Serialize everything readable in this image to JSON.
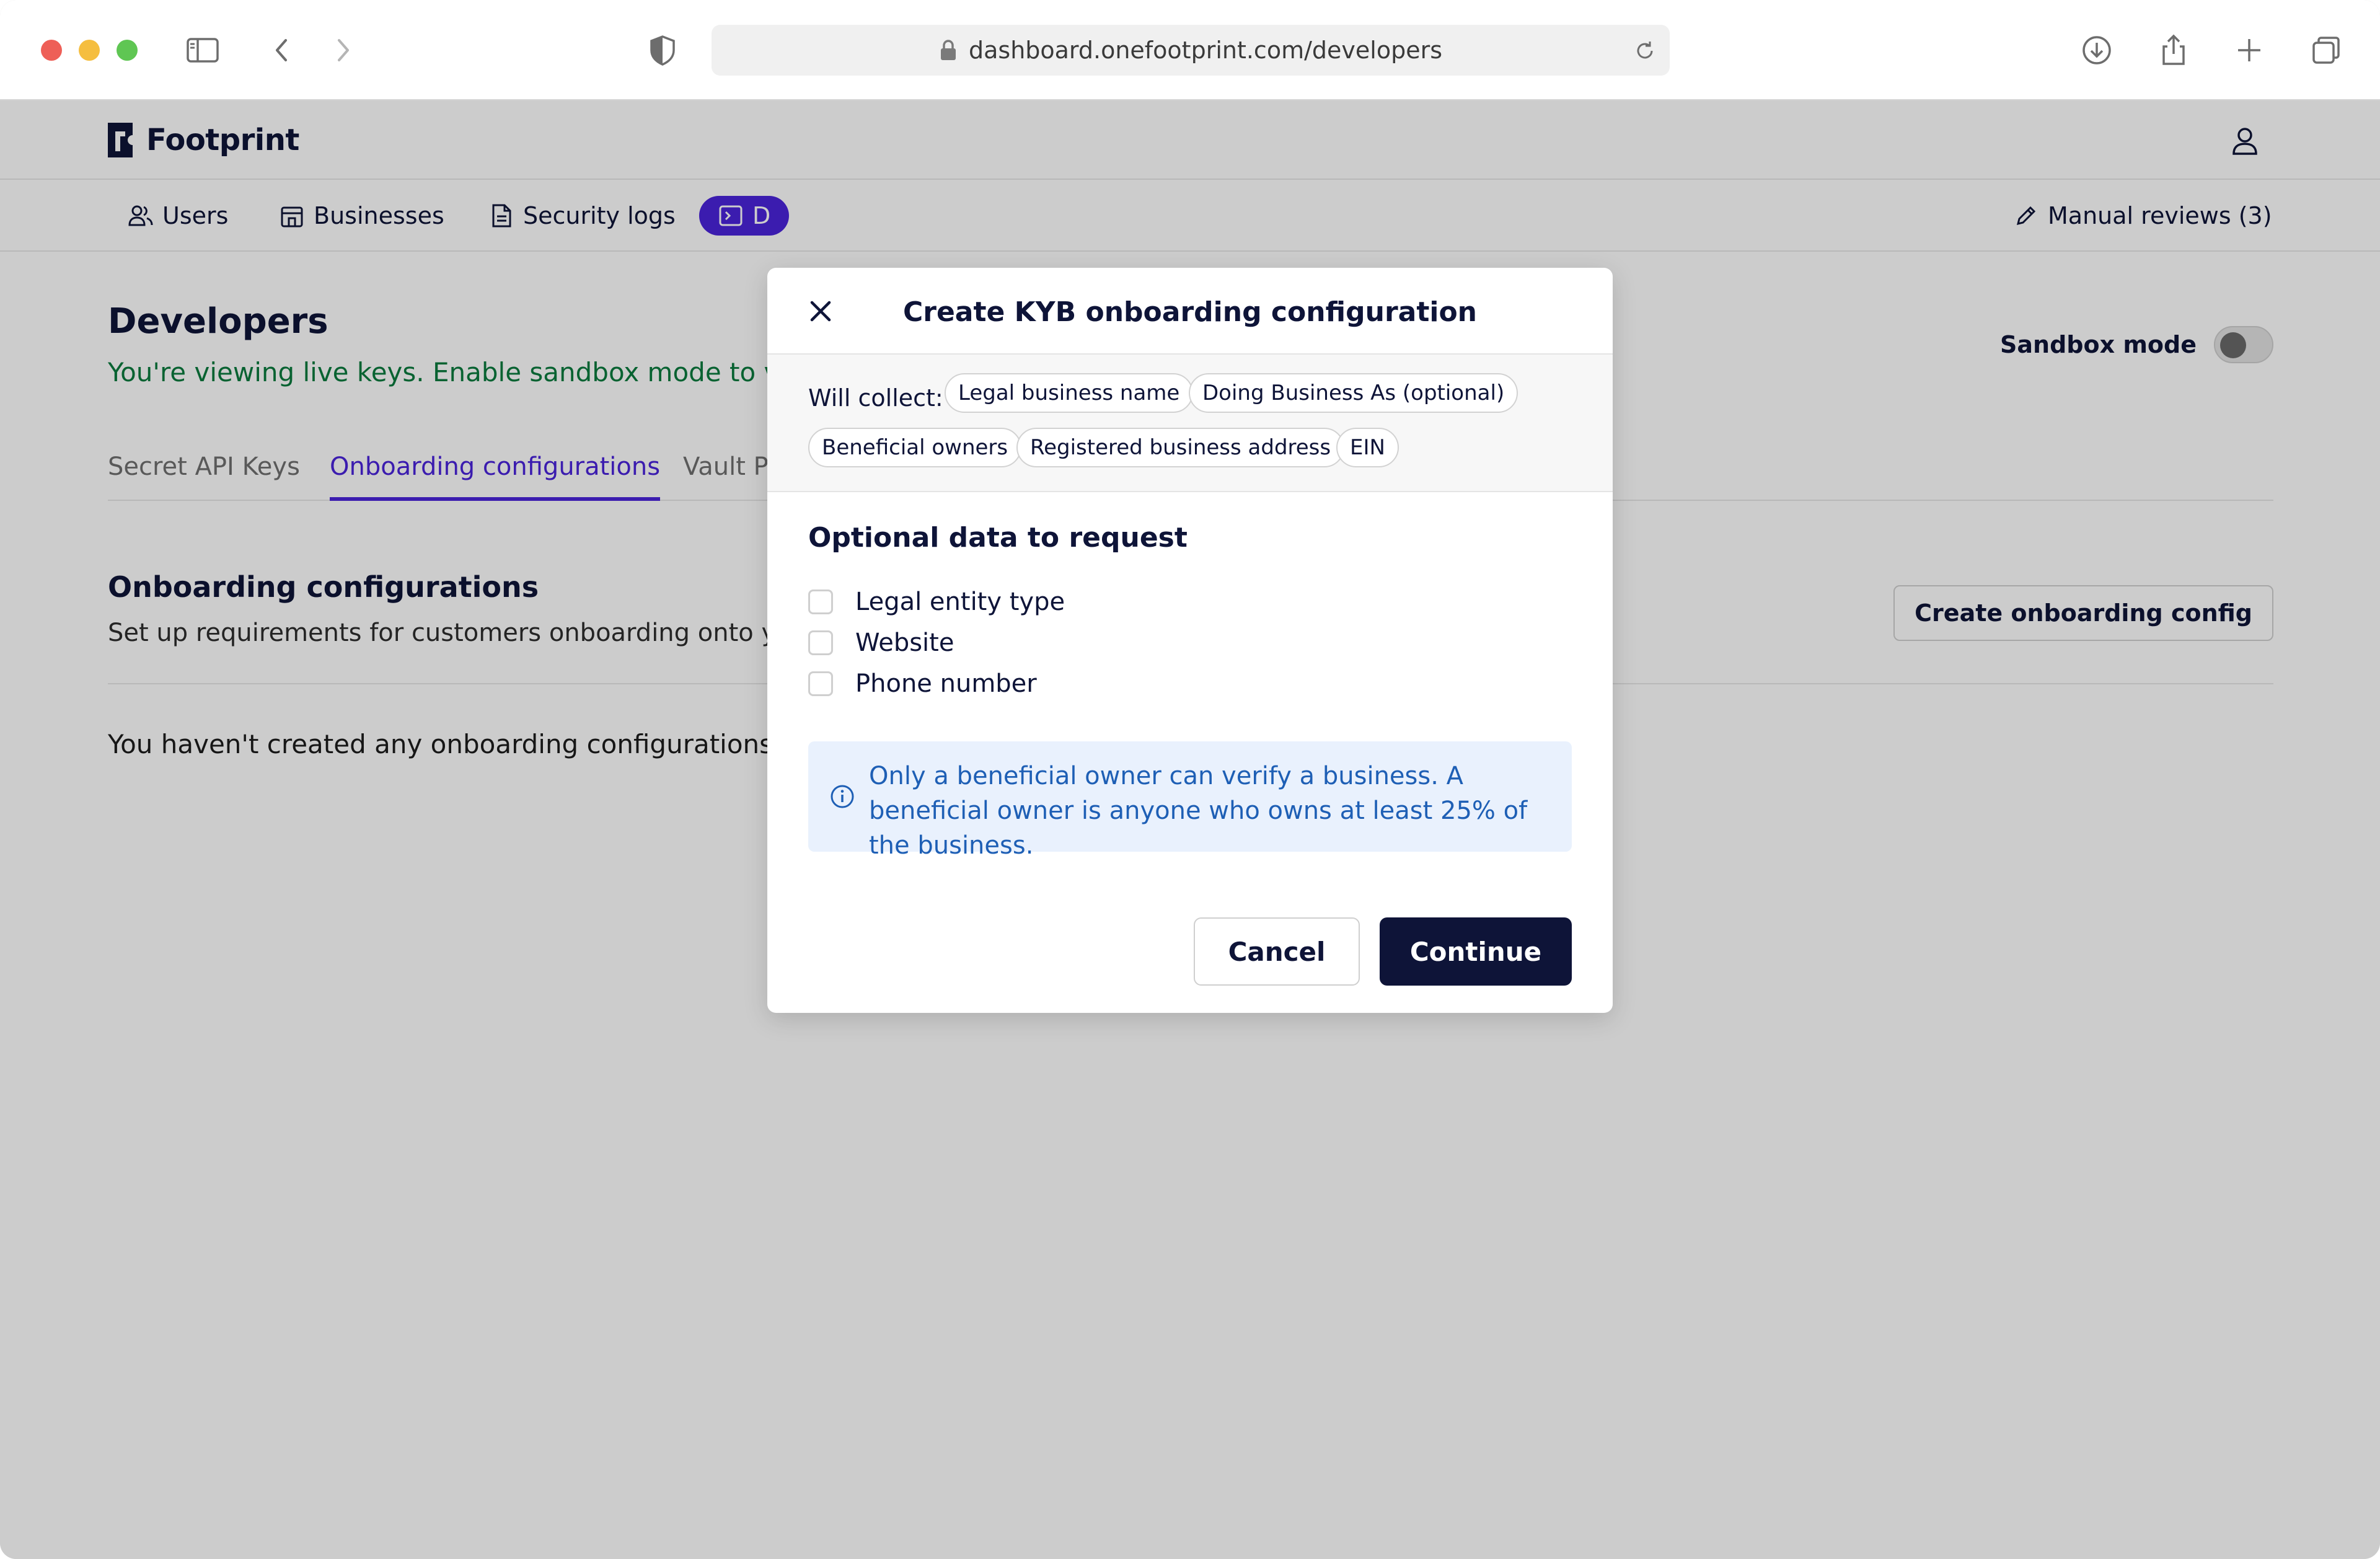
{
  "browser": {
    "url": "dashboard.onefootprint.com/developers"
  },
  "app": {
    "brand": "Footprint",
    "nav": {
      "users": "Users",
      "businesses": "Businesses",
      "security_logs": "Security logs",
      "developers_partial": "D",
      "manual_reviews": "Manual reviews (3)"
    },
    "page": {
      "title": "Developers",
      "subtitle": "You're viewing live keys. Enable sandbox mode to view",
      "sandbox_label": "Sandbox mode",
      "sandbox_on": false
    },
    "tabs": [
      "Secret API Keys",
      "Onboarding configurations",
      "Vault Pr"
    ],
    "active_tab": "Onboarding configurations",
    "section": {
      "title": "Onboarding configurations",
      "subtitle": "Set up requirements for customers onboarding onto you",
      "create_button": "Create onboarding config",
      "empty_text": "You haven't created any onboarding configurations ju"
    }
  },
  "modal": {
    "title": "Create KYB onboarding configuration",
    "will_collect_label": "Will collect:",
    "collect_items": [
      "Legal business name",
      "Doing Business As (optional)",
      "Beneficial owners",
      "Registered business address",
      "EIN"
    ],
    "optional_title": "Optional data to request",
    "optional_items": [
      {
        "label": "Legal entity type",
        "checked": false
      },
      {
        "label": "Website",
        "checked": false
      },
      {
        "label": "Phone number",
        "checked": false
      }
    ],
    "info_text": "Only a beneficial owner can verify a business. A beneficial owner is anyone who owns at least 25% of the business.",
    "cancel_label": "Cancel",
    "continue_label": "Continue"
  },
  "icons": {
    "close": "close-icon",
    "info": "info-icon",
    "lock": "lock-icon",
    "user": "user-icon"
  },
  "colors": {
    "accent": "#4a24db",
    "primary_button": "#0e1438",
    "sandbox_notice": "#0a7b3e",
    "info_background": "#e9f1fd",
    "info_text": "#1e5fb5"
  }
}
